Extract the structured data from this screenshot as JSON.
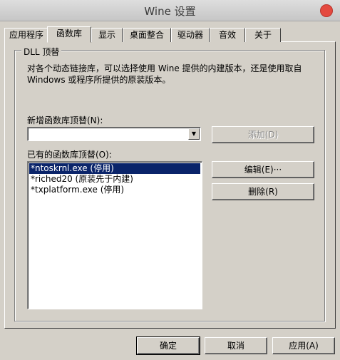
{
  "window": {
    "title": "Wine 设置"
  },
  "tabs": [
    {
      "label": "应用程序"
    },
    {
      "label": "函数库",
      "active": true
    },
    {
      "label": "显示"
    },
    {
      "label": "桌面整合"
    },
    {
      "label": "驱动器"
    },
    {
      "label": "音效"
    },
    {
      "label": "关于"
    }
  ],
  "group": {
    "title": "DLL 顶替",
    "description": "对各个动态链接库，可以选择使用 Wine 提供的内建版本，还是使用取自 Windows 或程序所提供的原装版本。"
  },
  "new_override": {
    "label": "新增函数库顶替(N):",
    "value": "",
    "add_button": "添加(D)"
  },
  "existing": {
    "label": "已有的函数库顶替(O):",
    "items": [
      "*ntoskrnl.exe (停用)",
      "*riched20 (原装先于内建)",
      "*txplatform.exe (停用)"
    ],
    "selected_index": 0,
    "edit_button": "编辑(E)···",
    "delete_button": "删除(R)"
  },
  "footer": {
    "ok": "确定",
    "cancel": "取消",
    "apply": "应用(A)"
  }
}
